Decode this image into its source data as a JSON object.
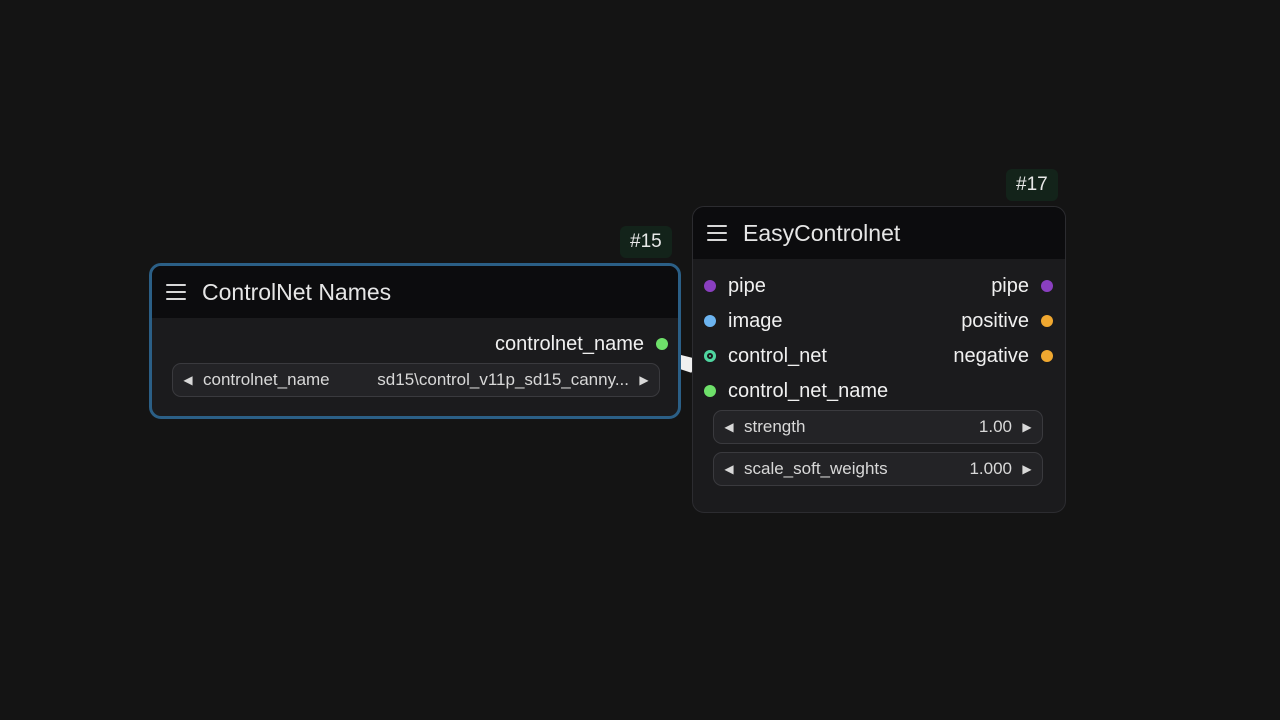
{
  "nodes": {
    "controlnet_names": {
      "id_badge": "#15",
      "title": "ControlNet Names",
      "output": {
        "label": "controlnet_name",
        "color": "#6ee06a"
      },
      "widget": {
        "label": "controlnet_name",
        "value": "sd15\\control_v11p_sd15_canny..."
      },
      "border_color": "#2b5f86"
    },
    "easy_controlnet": {
      "id_badge": "#17",
      "title": "EasyControlnet",
      "inputs": [
        {
          "label": "pipe",
          "color": "#8a3fc0",
          "icon": "dot"
        },
        {
          "label": "image",
          "color": "#6cb4f0",
          "icon": "dot"
        },
        {
          "label": "control_net",
          "color": "#4fd6a0",
          "icon": "ring-dot"
        },
        {
          "label": "control_net_name",
          "color": "#6ee06a",
          "icon": "dot"
        }
      ],
      "outputs": [
        {
          "label": "pipe",
          "color": "#8a3fc0"
        },
        {
          "label": "positive",
          "color": "#f0a830"
        },
        {
          "label": "negative",
          "color": "#f0a830"
        }
      ],
      "widgets": [
        {
          "label": "strength",
          "value": "1.00"
        },
        {
          "label": "scale_soft_weights",
          "value": "1.000"
        }
      ]
    }
  }
}
